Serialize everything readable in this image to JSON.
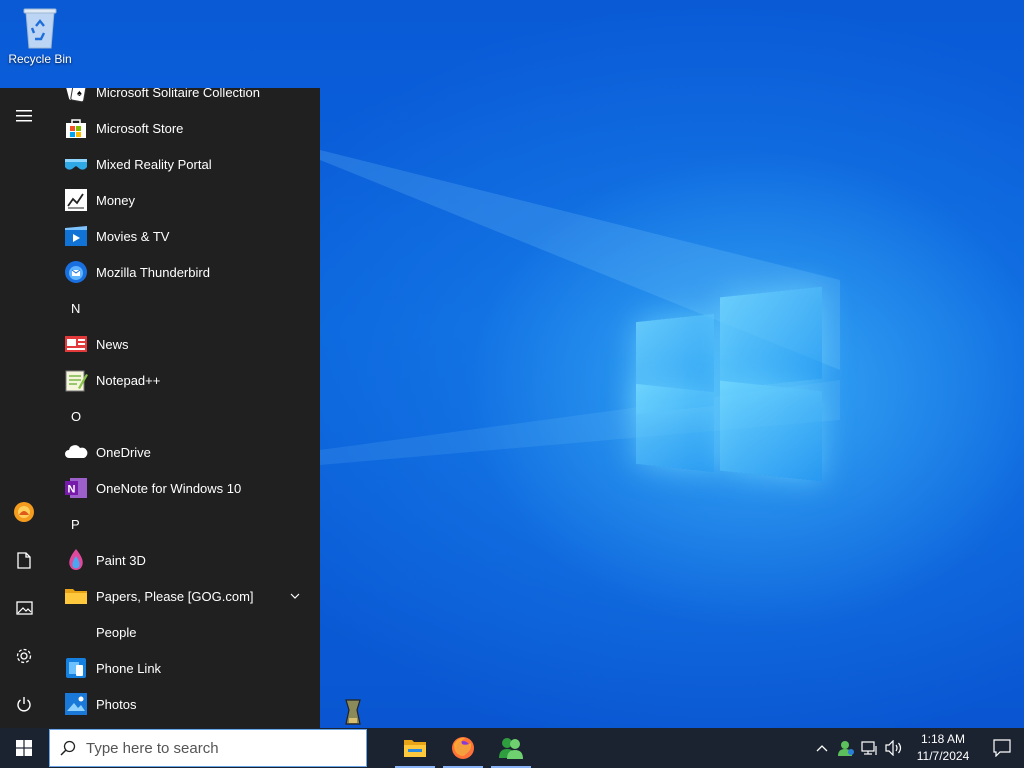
{
  "desktop": {
    "icons": [
      {
        "label": "Recycle Bin",
        "icon": "recycle-bin-icon"
      }
    ]
  },
  "start_menu": {
    "rail": {
      "items": [
        {
          "name": "expand-menu",
          "icon": "hamburger-icon"
        },
        {
          "name": "user-account",
          "icon": "avatar-icon"
        },
        {
          "name": "documents",
          "icon": "document-icon"
        },
        {
          "name": "pictures",
          "icon": "pictures-icon"
        },
        {
          "name": "settings",
          "icon": "gear-icon"
        },
        {
          "name": "power",
          "icon": "power-icon"
        }
      ]
    },
    "apps": [
      {
        "type": "app",
        "label": "Microsoft Solitaire Collection",
        "icon": "cards-icon"
      },
      {
        "type": "app",
        "label": "Microsoft Store",
        "icon": "store-icon"
      },
      {
        "type": "app",
        "label": "Mixed Reality Portal",
        "icon": "mixed-reality-icon"
      },
      {
        "type": "app",
        "label": "Money",
        "icon": "money-chart-icon"
      },
      {
        "type": "app",
        "label": "Movies & TV",
        "icon": "movies-icon"
      },
      {
        "type": "app",
        "label": "Mozilla Thunderbird",
        "icon": "thunderbird-icon"
      },
      {
        "type": "letter",
        "label": "N"
      },
      {
        "type": "app",
        "label": "News",
        "icon": "news-icon"
      },
      {
        "type": "app",
        "label": "Notepad++",
        "icon": "notepadpp-icon"
      },
      {
        "type": "letter",
        "label": "O"
      },
      {
        "type": "app",
        "label": "OneDrive",
        "icon": "cloud-icon"
      },
      {
        "type": "app",
        "label": "OneNote for Windows 10",
        "icon": "onenote-icon"
      },
      {
        "type": "letter",
        "label": "P"
      },
      {
        "type": "app",
        "label": "Paint 3D",
        "icon": "paint3d-icon"
      },
      {
        "type": "folder",
        "label": "Papers, Please [GOG.com]",
        "icon": "folder-icon"
      },
      {
        "type": "app",
        "label": "People",
        "icon": ""
      },
      {
        "type": "app",
        "label": "Phone Link",
        "icon": "phone-link-icon"
      },
      {
        "type": "app",
        "label": "Photos",
        "icon": "photos-icon"
      }
    ]
  },
  "taskbar": {
    "search": {
      "placeholder": "Type here to search",
      "value": ""
    },
    "pinned": [
      {
        "name": "file-explorer",
        "icon": "folder-icon",
        "running": true
      },
      {
        "name": "firefox",
        "icon": "firefox-icon",
        "running": true
      },
      {
        "name": "people-app",
        "icon": "people-icon",
        "running": true
      }
    ],
    "tray": {
      "time": "1:18 AM",
      "date": "11/7/2024"
    }
  }
}
